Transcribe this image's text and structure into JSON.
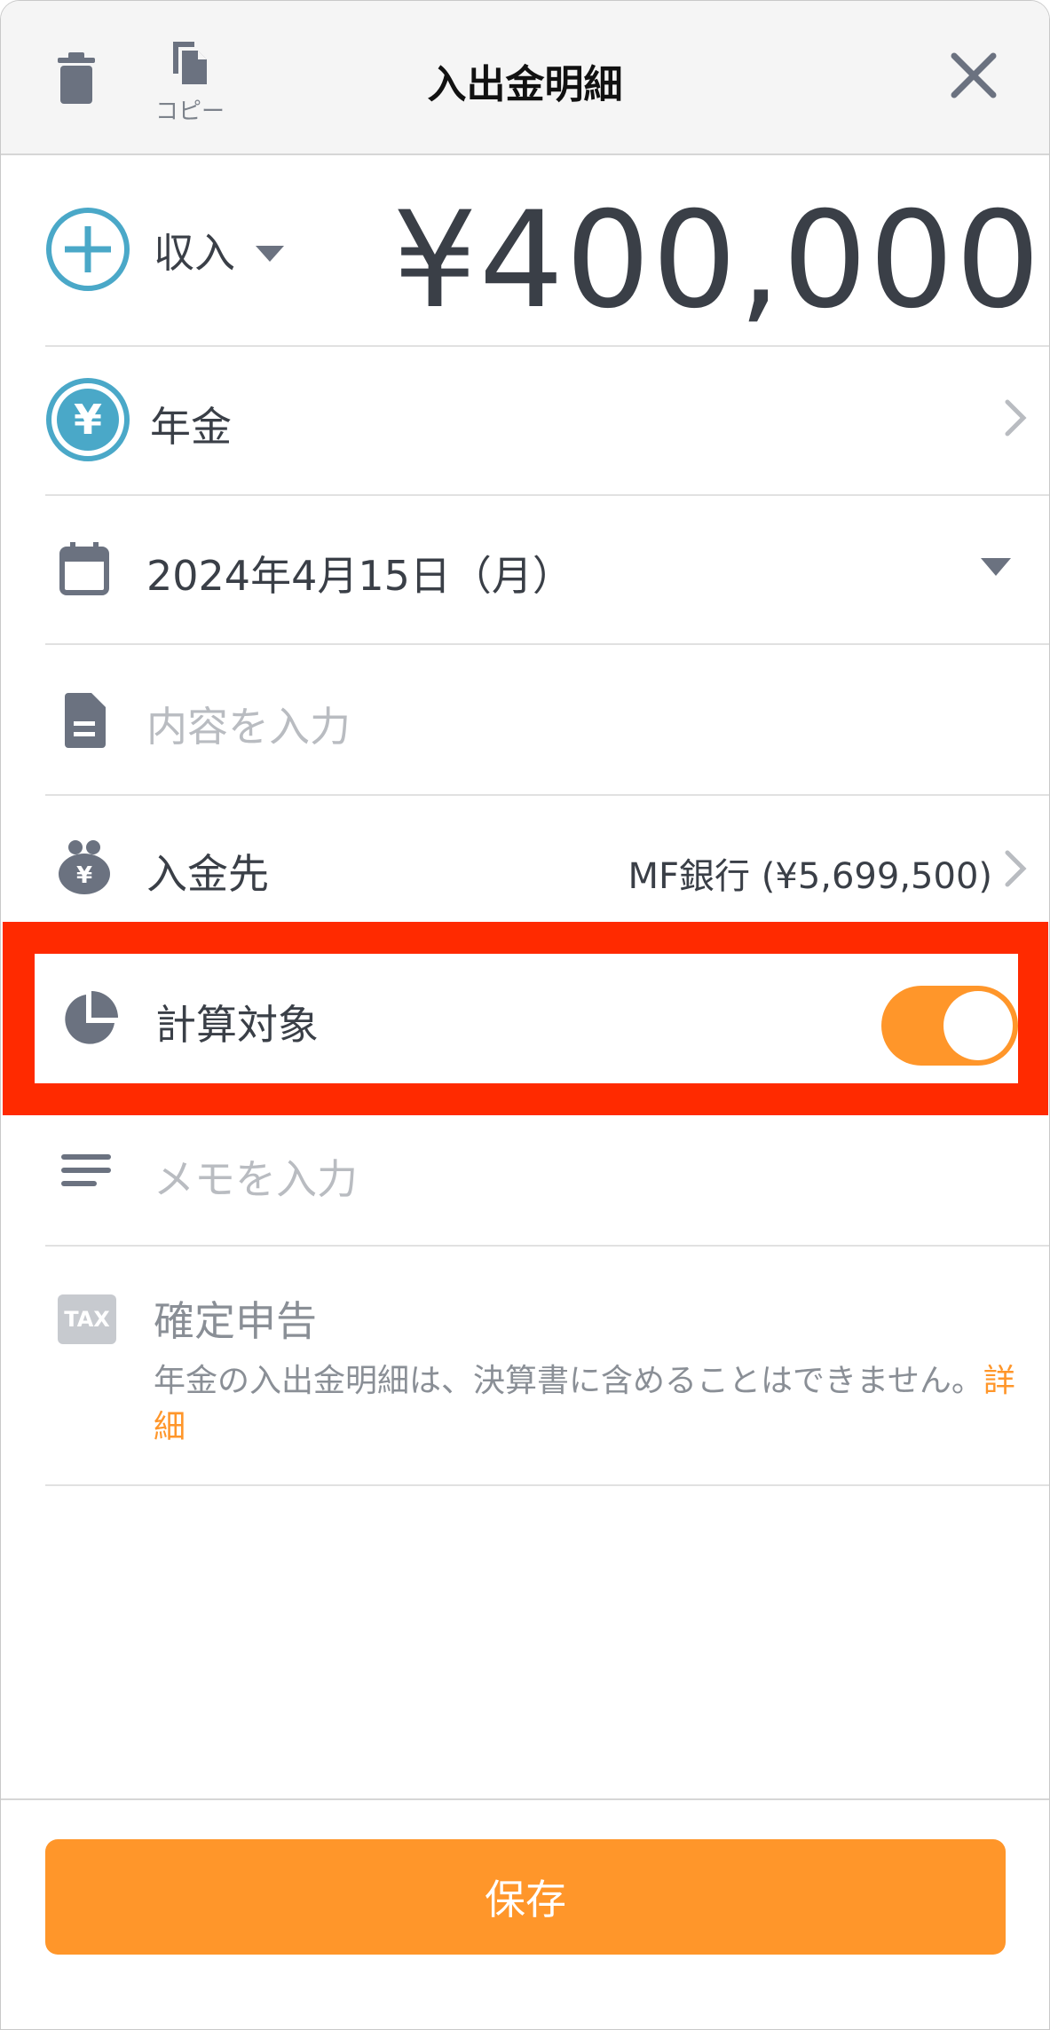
{
  "header": {
    "title": "入出金明細",
    "copy_label": "コピー"
  },
  "entry": {
    "type_label": "収入",
    "amount": "¥400,000",
    "category": "年金",
    "date": "2024年4月15日（月）",
    "content_placeholder": "内容を入力",
    "account_label": "入金先",
    "account_value": "MF銀行 (¥5,699,500)",
    "calc_target_label": "計算対象",
    "calc_target_on": true,
    "memo_placeholder": "メモを入力",
    "tax_badge": "TAX",
    "tax_title": "確定申告",
    "tax_note": "年金の入出金明細は、決算書に含めることはできません。",
    "tax_link": "詳細"
  },
  "footer": {
    "save_label": "保存"
  },
  "colors": {
    "accent": "#ff962a",
    "income_blue": "#4aa8c8",
    "highlight": "#ff2a00",
    "icon_gray": "#6b7280"
  },
  "icons": [
    "trash-icon",
    "copy-icon",
    "close-icon",
    "plus-circle-icon",
    "caret-down-icon",
    "yen-circle-icon",
    "chevron-right-icon",
    "calendar-icon",
    "document-icon",
    "wallet-icon",
    "pie-chart-icon",
    "memo-lines-icon",
    "tax-badge-icon"
  ]
}
